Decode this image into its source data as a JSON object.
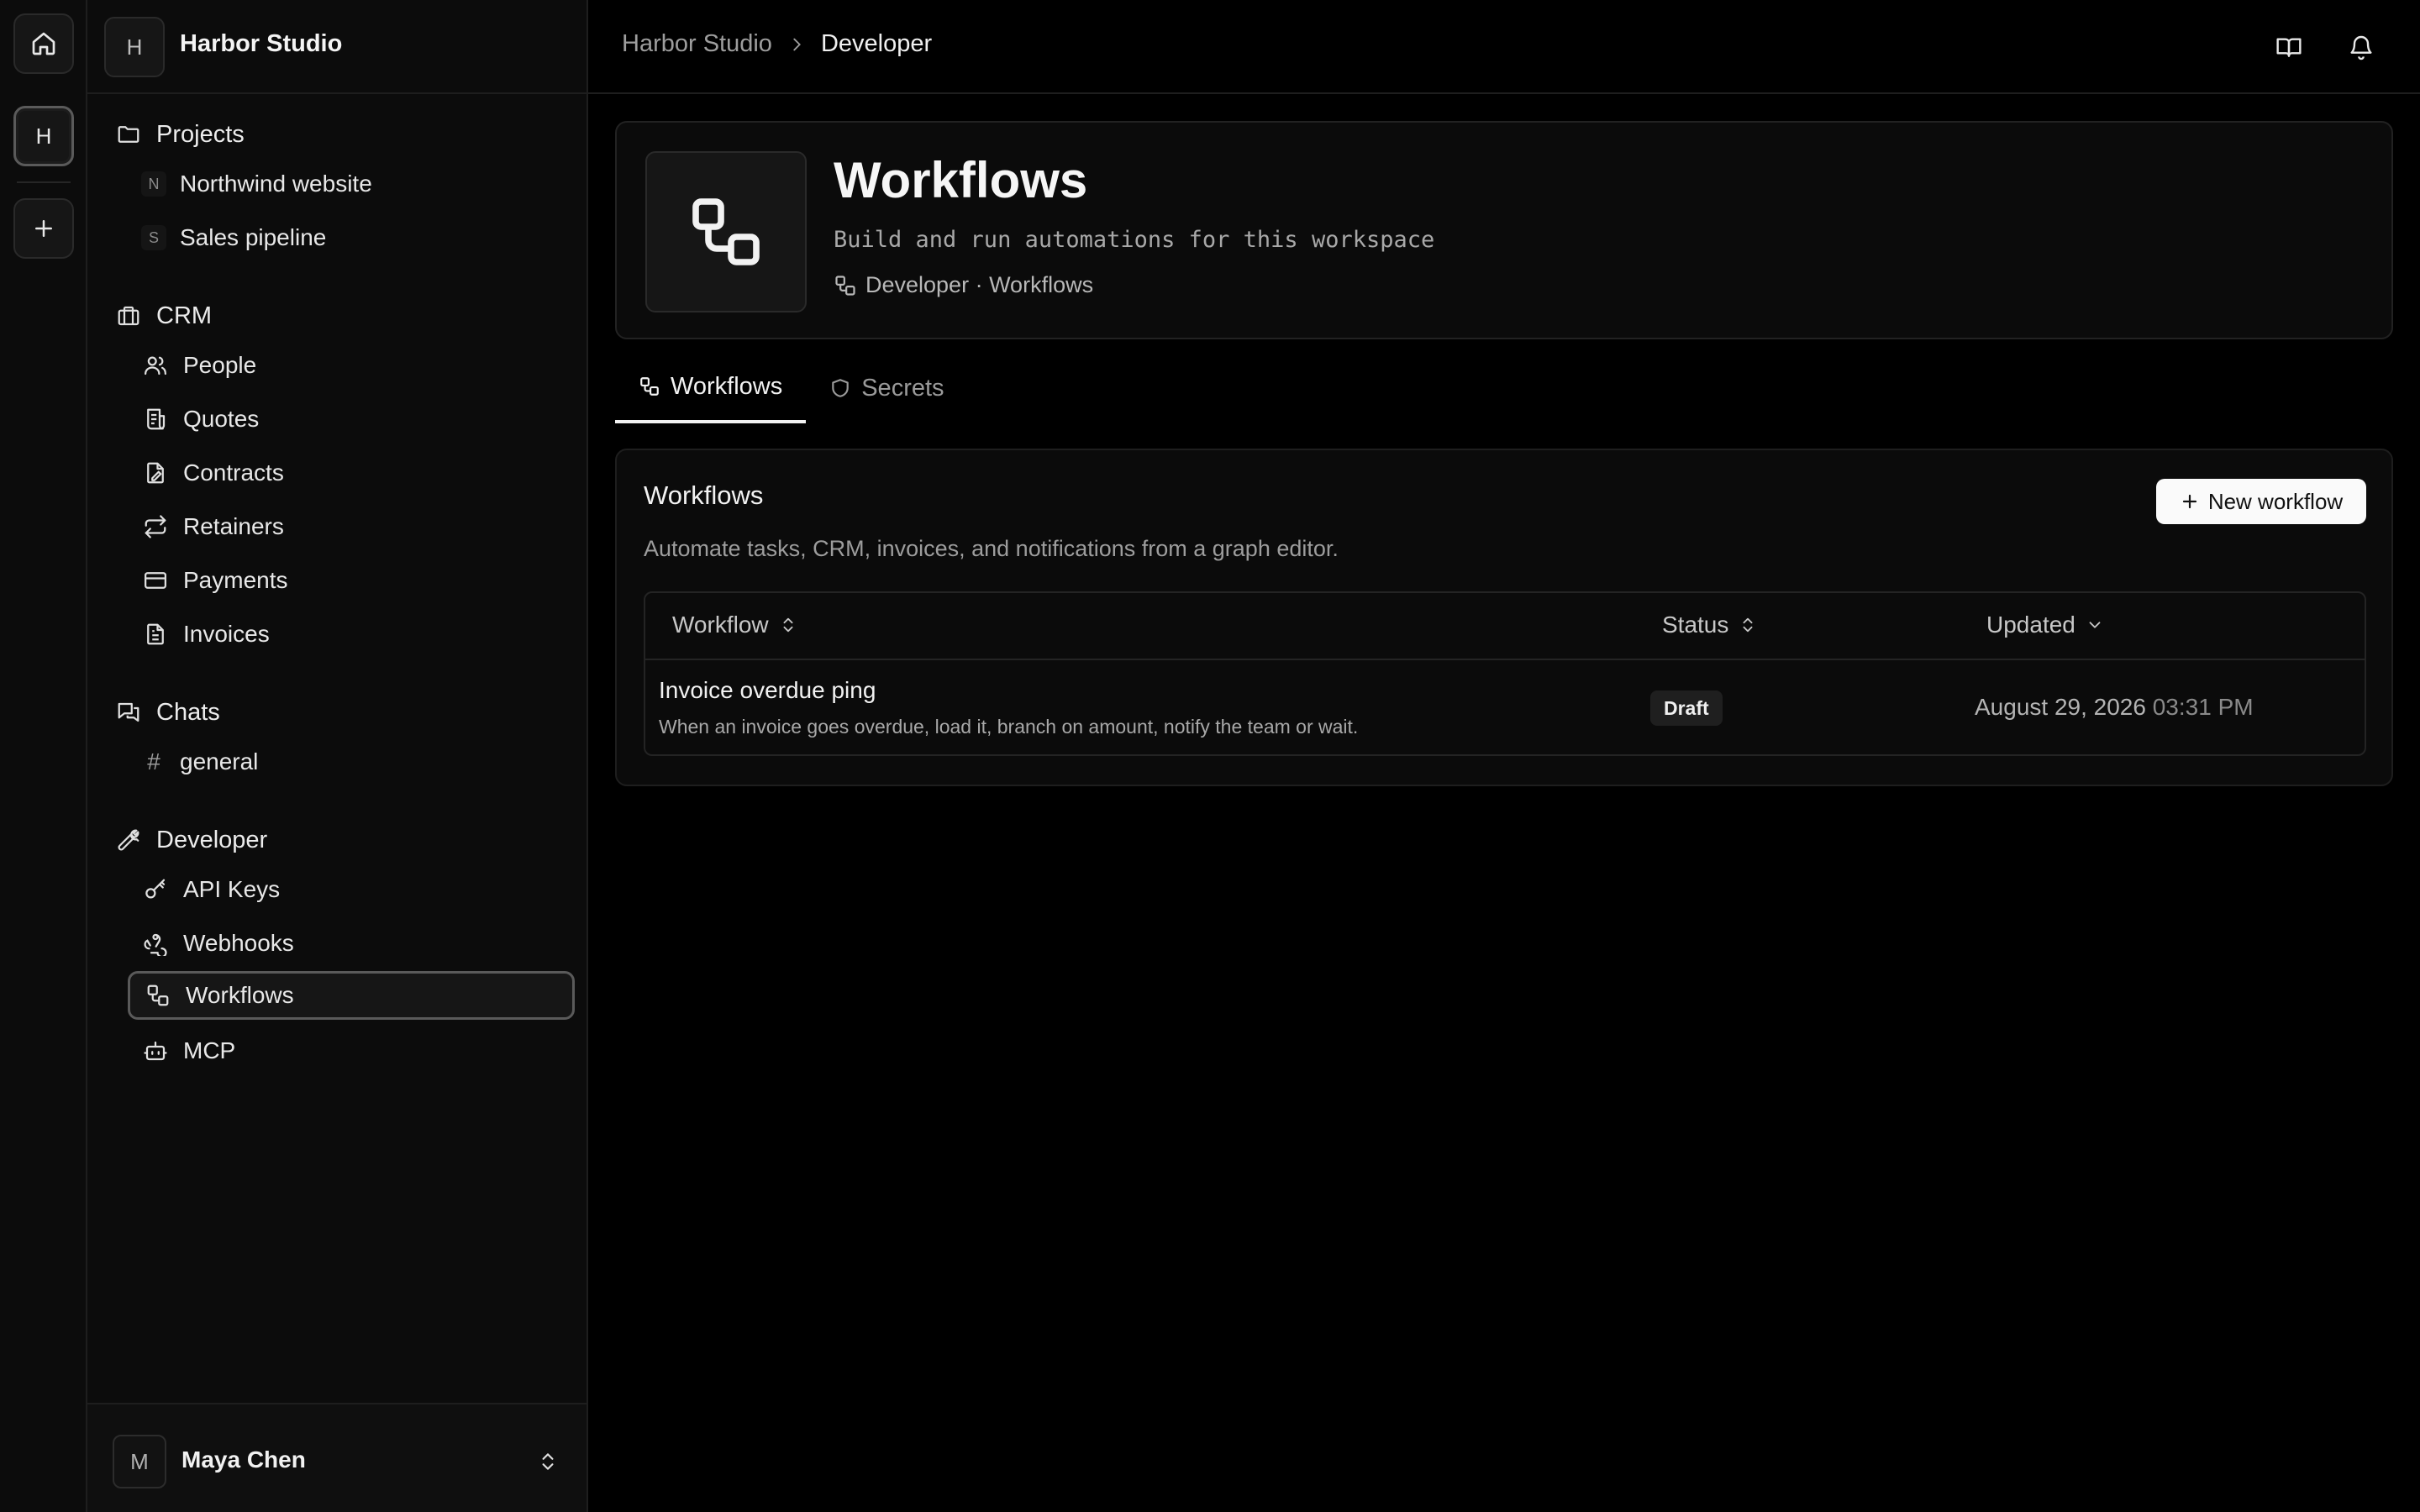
{
  "rail": {
    "workspace_initial": "H",
    "add_label": "+"
  },
  "workspace": {
    "initial": "H",
    "name": "Harbor Studio"
  },
  "sidebar": {
    "projects": {
      "label": "Projects",
      "items": [
        {
          "letter": "N",
          "label": "Northwind website"
        },
        {
          "letter": "S",
          "label": "Sales pipeline"
        }
      ]
    },
    "crm": {
      "label": "CRM",
      "items": [
        {
          "label": "People",
          "icon": "users-icon"
        },
        {
          "label": "Quotes",
          "icon": "receipt-icon"
        },
        {
          "label": "Contracts",
          "icon": "file-signature-icon"
        },
        {
          "label": "Retainers",
          "icon": "repeat-icon"
        },
        {
          "label": "Payments",
          "icon": "credit-card-icon"
        },
        {
          "label": "Invoices",
          "icon": "file-text-icon"
        }
      ]
    },
    "chats": {
      "label": "Chats",
      "items": [
        {
          "label": "general"
        }
      ]
    },
    "developer": {
      "label": "Developer",
      "items": [
        {
          "label": "API Keys",
          "icon": "key-icon"
        },
        {
          "label": "Webhooks",
          "icon": "webhook-icon"
        },
        {
          "label": "Workflows",
          "icon": "workflow-icon",
          "active": true
        },
        {
          "label": "MCP",
          "icon": "bot-icon"
        }
      ]
    }
  },
  "user": {
    "initial": "M",
    "name": "Maya Chen"
  },
  "breadcrumb": {
    "parent": "Harbor Studio",
    "current": "Developer"
  },
  "header": {
    "title": "Workflows",
    "subtitle": "Build and run automations for this workspace",
    "meta": "Developer · Workflows"
  },
  "tabs": [
    {
      "label": "Workflows",
      "active": true
    },
    {
      "label": "Secrets",
      "active": false
    }
  ],
  "content": {
    "title": "Workflows",
    "description": "Automate tasks, CRM, invoices, and notifications from a graph editor.",
    "new_button": "New workflow",
    "columns": {
      "workflow": "Workflow",
      "status": "Status",
      "updated": "Updated"
    },
    "rows": [
      {
        "name": "Invoice overdue ping",
        "description": "When an invoice goes overdue, load it, branch on amount, notify the team or wait.",
        "status": "Draft",
        "updated_date": "August 29, 2026",
        "updated_time": "03:31 PM"
      }
    ]
  },
  "colors": {
    "background": "#000000",
    "sidebar": "#0c0c0c",
    "border": "#1e1e1e",
    "text": "#f2f2f2",
    "muted": "#9d9d9d",
    "button_bg": "#fafafa"
  }
}
